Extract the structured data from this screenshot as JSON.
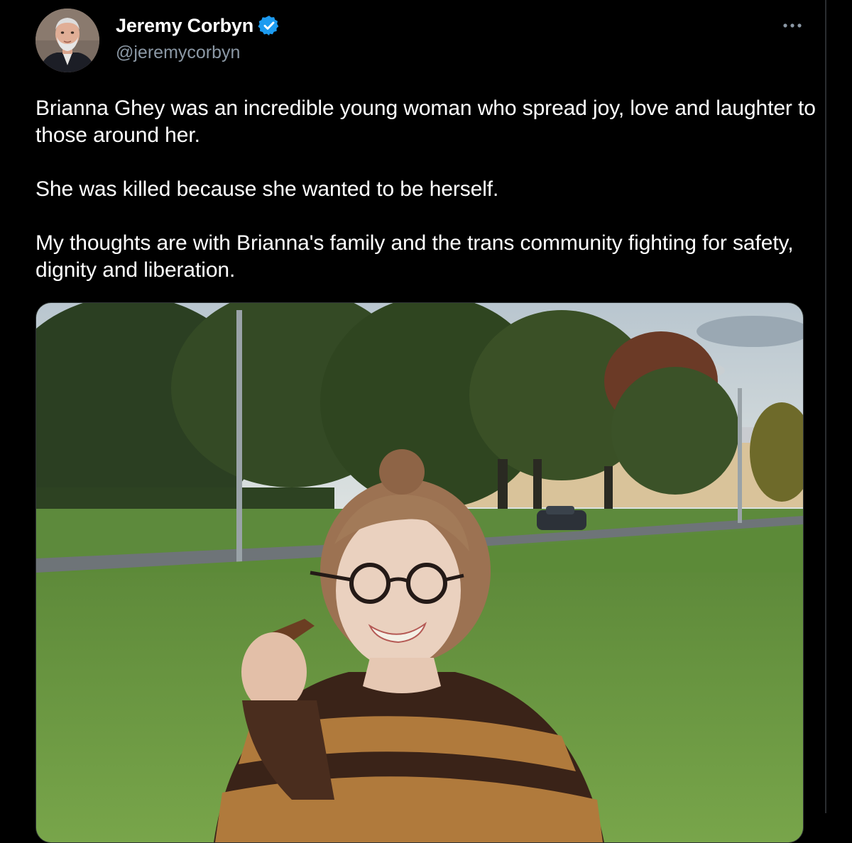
{
  "author": {
    "display_name": "Jeremy Corbyn",
    "handle": "@jeremycorbyn",
    "verified": true,
    "avatar_icon": "profile-photo",
    "verified_icon": "verified-badge-icon"
  },
  "tweet": {
    "paragraphs": [
      "Brianna Ghey was an incredible young woman who spread joy, love and laughter to those around her.",
      "She was killed because she wanted to be herself.",
      "My thoughts are with Brianna's family and the trans community fighting for safety, dignity and liberation."
    ]
  },
  "menu": {
    "icon": "more-options-icon"
  },
  "media": {
    "type": "photo"
  },
  "colors": {
    "background": "#000000",
    "text": "#ffffff",
    "secondary_text": "#8b98a5",
    "verified_blue": "#1d9bf0"
  }
}
